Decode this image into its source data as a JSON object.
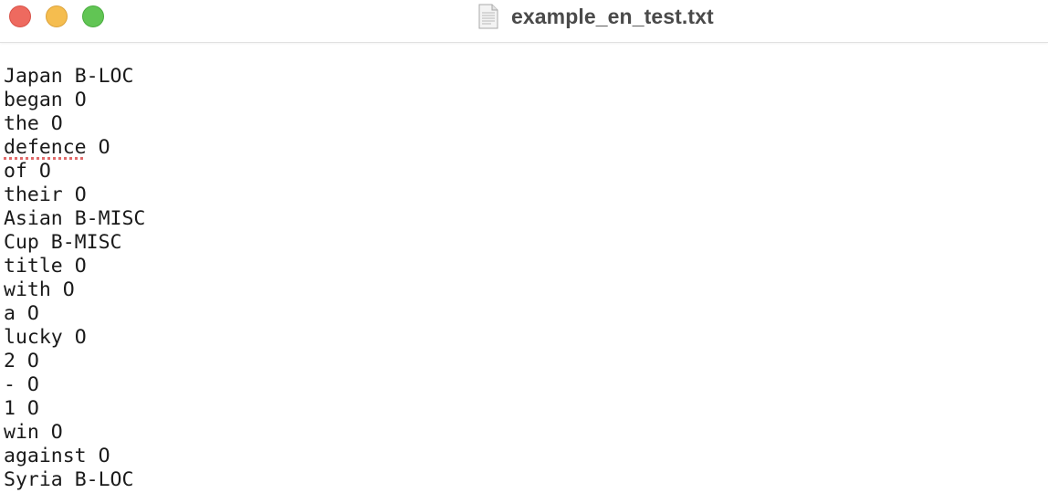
{
  "window": {
    "title": "example_en_test.txt",
    "title_icon": "text-document-icon",
    "controls": {
      "close": {
        "icon": "close-traffic-light",
        "color": "#ee6a5f"
      },
      "minimize": {
        "icon": "minimize-traffic-light",
        "color": "#f5bd4f"
      },
      "zoom": {
        "icon": "zoom-traffic-light",
        "color": "#61c554"
      }
    }
  },
  "document": {
    "lines": [
      {
        "word": "Japan",
        "tag": "B-LOC",
        "misspelled": false
      },
      {
        "word": "began",
        "tag": "O",
        "misspelled": false
      },
      {
        "word": "the",
        "tag": "O",
        "misspelled": false
      },
      {
        "word": "defence",
        "tag": "O",
        "misspelled": true
      },
      {
        "word": "of",
        "tag": "O",
        "misspelled": false
      },
      {
        "word": "their",
        "tag": "O",
        "misspelled": false
      },
      {
        "word": "Asian",
        "tag": "B-MISC",
        "misspelled": false
      },
      {
        "word": "Cup",
        "tag": "B-MISC",
        "misspelled": false
      },
      {
        "word": "title",
        "tag": "O",
        "misspelled": false
      },
      {
        "word": "with",
        "tag": "O",
        "misspelled": false
      },
      {
        "word": "a",
        "tag": "O",
        "misspelled": false
      },
      {
        "word": "lucky",
        "tag": "O",
        "misspelled": false
      },
      {
        "word": "2",
        "tag": "O",
        "misspelled": false
      },
      {
        "word": "-",
        "tag": "O",
        "misspelled": false
      },
      {
        "word": "1",
        "tag": "O",
        "misspelled": false
      },
      {
        "word": "win",
        "tag": "O",
        "misspelled": false
      },
      {
        "word": "against",
        "tag": "O",
        "misspelled": false
      },
      {
        "word": "Syria",
        "tag": "B-LOC",
        "misspelled": false
      }
    ],
    "spellcheck_underline_color": "#e06a6a"
  }
}
